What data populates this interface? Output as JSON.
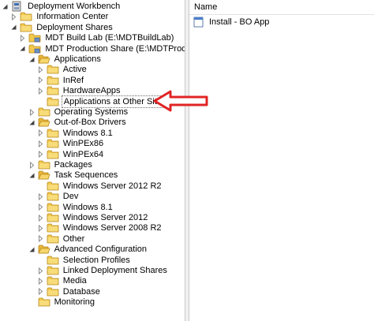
{
  "tree": {
    "items": [
      {
        "label": "Deployment Workbench",
        "icon": "workbench-icon",
        "expander": "open",
        "indent": 0
      },
      {
        "label": "Information Center",
        "icon": "folder-icon",
        "expander": "closed",
        "indent": 1
      },
      {
        "label": "Deployment Shares",
        "icon": "folder-icon",
        "expander": "open",
        "indent": 1
      },
      {
        "label": "MDT Build Lab (E:\\MDTBuildLab)",
        "icon": "deployment-share-icon",
        "expander": "closed",
        "indent": 2
      },
      {
        "label": "MDT Production Share (E:\\MDTProduction)",
        "icon": "deployment-share-icon",
        "expander": "open",
        "indent": 2
      },
      {
        "label": "Applications",
        "icon": "folder-open-icon",
        "expander": "open",
        "indent": 3
      },
      {
        "label": "Active",
        "icon": "folder-icon",
        "expander": "closed",
        "indent": 4
      },
      {
        "label": "InRef",
        "icon": "folder-icon",
        "expander": "closed",
        "indent": 4
      },
      {
        "label": "HardwareApps",
        "icon": "folder-icon",
        "expander": "closed",
        "indent": 4
      },
      {
        "label": "Applications at Other Site",
        "icon": "folder-icon",
        "expander": "none",
        "indent": 4,
        "selected": true
      },
      {
        "label": "Operating Systems",
        "icon": "folder-icon",
        "expander": "closed",
        "indent": 3
      },
      {
        "label": "Out-of-Box Drivers",
        "icon": "folder-open-icon",
        "expander": "open",
        "indent": 3
      },
      {
        "label": "Windows 8.1",
        "icon": "folder-icon",
        "expander": "closed",
        "indent": 4
      },
      {
        "label": "WinPEx86",
        "icon": "folder-icon",
        "expander": "closed",
        "indent": 4
      },
      {
        "label": "WinPEx64",
        "icon": "folder-icon",
        "expander": "closed",
        "indent": 4
      },
      {
        "label": "Packages",
        "icon": "folder-icon",
        "expander": "closed",
        "indent": 3
      },
      {
        "label": "Task Sequences",
        "icon": "folder-open-icon",
        "expander": "open",
        "indent": 3
      },
      {
        "label": "Windows Server 2012 R2",
        "icon": "folder-icon",
        "expander": "none",
        "indent": 4
      },
      {
        "label": "Dev",
        "icon": "folder-icon",
        "expander": "closed",
        "indent": 4
      },
      {
        "label": "Windows 8.1",
        "icon": "folder-icon",
        "expander": "closed",
        "indent": 4
      },
      {
        "label": "Windows Server 2012",
        "icon": "folder-icon",
        "expander": "closed",
        "indent": 4
      },
      {
        "label": "Windows Server 2008 R2",
        "icon": "folder-icon",
        "expander": "closed",
        "indent": 4
      },
      {
        "label": "Other",
        "icon": "folder-icon",
        "expander": "closed",
        "indent": 4
      },
      {
        "label": "Advanced Configuration",
        "icon": "folder-open-icon",
        "expander": "open",
        "indent": 3
      },
      {
        "label": "Selection Profiles",
        "icon": "folder-icon",
        "expander": "none",
        "indent": 4
      },
      {
        "label": "Linked Deployment Shares",
        "icon": "folder-icon",
        "expander": "closed",
        "indent": 4
      },
      {
        "label": "Media",
        "icon": "folder-icon",
        "expander": "closed",
        "indent": 4
      },
      {
        "label": "Database",
        "icon": "folder-icon",
        "expander": "closed",
        "indent": 4
      },
      {
        "label": "Monitoring",
        "icon": "folder-icon",
        "expander": "none",
        "indent": 3
      }
    ]
  },
  "list": {
    "column_name": "Name",
    "rows": [
      {
        "label": "Install - BO App",
        "icon": "application-icon"
      }
    ]
  },
  "annotation": {
    "arrow": "red-arrow-icon",
    "color": "#e02424"
  },
  "colors": {
    "folder": "#f2c94c",
    "folder_dark": "#d9a520",
    "splitter": "#f0f0f0"
  }
}
